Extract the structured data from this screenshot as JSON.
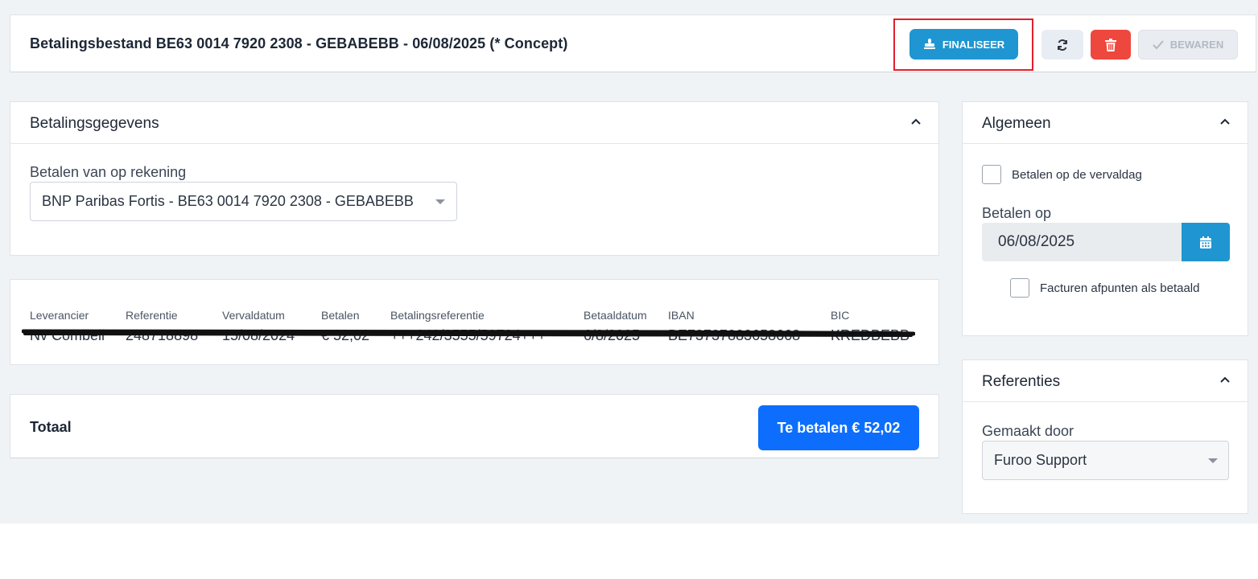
{
  "header": {
    "title": "Betalingsbestand BE63 0014 7920 2308 - GEBABEBB - 06/08/2025 (* Concept)",
    "finalize_label": "FINALISEER",
    "save_label": "BEWAREN"
  },
  "payment": {
    "section_title": "Betalingsgegevens",
    "account_label": "Betalen van op rekening",
    "account_value": "BNP Paribas Fortis - BE63 0014 7920 2308 - GEBABEBB"
  },
  "table": {
    "columns": [
      "Leverancier",
      "Referentie",
      "Vervaldatum",
      "Betalen",
      "Betalingsreferentie",
      "Betaaldatum",
      "IBAN",
      "BIC"
    ],
    "rows": [
      [
        "Nv Combell",
        "248718898",
        "15/08/2024",
        "€ 52,02",
        "+++242/3555/59724+++",
        "6/8/2025",
        "BE73737883658668",
        "KREDBEBB"
      ]
    ]
  },
  "total": {
    "label": "Totaal",
    "to_pay_label": "Te betalen € 52,02"
  },
  "general": {
    "section_title": "Algemeen",
    "pay_on_due_label": "Betalen op de vervaldag",
    "pay_on_label": "Betalen op",
    "pay_on_value": "06/08/2025",
    "mark_paid_label": "Facturen afpunten als betaald"
  },
  "references": {
    "section_title": "Referenties",
    "created_by_label": "Gemaakt door",
    "created_by_value": "Furoo Support"
  },
  "colors": {
    "primary": "#1f96d1",
    "danger": "#ee473d",
    "accent_blue": "#0d6efd",
    "highlight": "#e0202b"
  }
}
